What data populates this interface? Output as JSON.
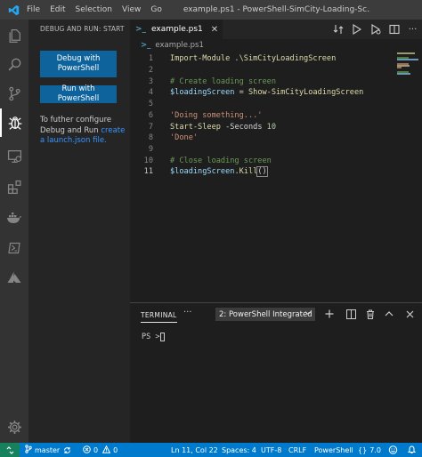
{
  "titlebar": {
    "menu": [
      "File",
      "Edit",
      "Selection",
      "View",
      "Go"
    ],
    "window_title": "example.ps1 - PowerShell-SimCity-Loading-Sc..."
  },
  "activitybar": {
    "icons": [
      "explorer-icon",
      "search-icon",
      "source-control-icon",
      "debug-icon",
      "remote-explorer-icon",
      "extensions-icon",
      "docker-icon",
      "powershell-icon",
      "azure-icon",
      "settings-gear-icon"
    ]
  },
  "sidebar": {
    "title": "DEBUG AND RUN: START",
    "debug_button": "Debug with PowerShell",
    "run_button": "Run with PowerShell",
    "config_text": "To futher configure Debug and Run ",
    "config_link": "create a launch.json file."
  },
  "editor": {
    "tab_label": "example.ps1",
    "breadcrumb": "example.ps1",
    "lines": [
      {
        "n": "1",
        "tokens": [
          {
            "t": "Import-Module .\\SimCityLoadingScreen",
            "c": "cmd"
          }
        ]
      },
      {
        "n": "2",
        "tokens": []
      },
      {
        "n": "3",
        "tokens": [
          {
            "t": "# Create loading screen",
            "c": "cmt"
          }
        ]
      },
      {
        "n": "4",
        "tokens": [
          {
            "t": "$loadingScreen",
            "c": "var"
          },
          {
            "t": " = ",
            "c": "txt"
          },
          {
            "t": "Show-SimCityLoadingScreen",
            "c": "cmd"
          }
        ]
      },
      {
        "n": "5",
        "tokens": []
      },
      {
        "n": "6",
        "tokens": [
          {
            "t": "'Doing something...'",
            "c": "str"
          }
        ]
      },
      {
        "n": "7",
        "tokens": [
          {
            "t": "Start-Sleep",
            "c": "cmd"
          },
          {
            "t": " -Seconds ",
            "c": "txt"
          },
          {
            "t": "10",
            "c": "num"
          }
        ]
      },
      {
        "n": "8",
        "tokens": [
          {
            "t": "'Done'",
            "c": "str"
          }
        ]
      },
      {
        "n": "9",
        "tokens": []
      },
      {
        "n": "10",
        "tokens": [
          {
            "t": "# Close loading screen",
            "c": "cmt"
          }
        ]
      },
      {
        "n": "11",
        "tokens": [
          {
            "t": "$loadingScreen",
            "c": "var"
          },
          {
            "t": ".",
            "c": "txt"
          },
          {
            "t": "Kill",
            "c": "cmd"
          },
          {
            "t": "()",
            "c": "txt"
          }
        ]
      }
    ]
  },
  "panel": {
    "title": "TERMINAL",
    "more": "···",
    "terminal_select": "2: PowerShell Integrated",
    "prompt": "PS >"
  },
  "statusbar": {
    "branch": "master",
    "errors": "0",
    "warnings": "0",
    "position": "Ln 11, Col 22",
    "spaces": "Spaces: 4",
    "encoding": "UTF-8",
    "eol": "CRLF",
    "language": "PowerShell",
    "ps_version": "7.0"
  },
  "colors": {
    "accent": "#007acc",
    "button": "#0e639c",
    "remote": "#16825d"
  }
}
